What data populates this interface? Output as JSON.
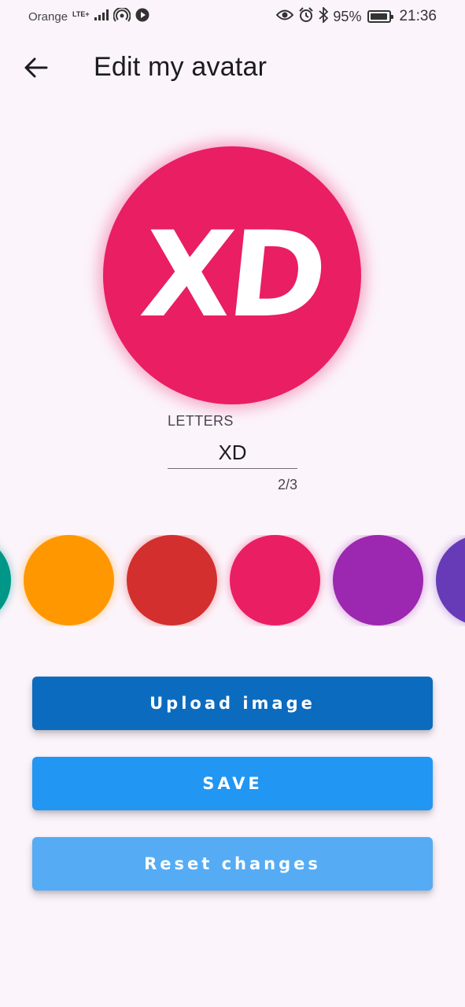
{
  "status_bar": {
    "carrier": "Orange",
    "network": "LTE+",
    "battery": "95%",
    "battery_level": 0.95,
    "time": "21:36"
  },
  "header": {
    "title": "Edit my avatar"
  },
  "avatar": {
    "letters": "XD",
    "color": "#e91e63"
  },
  "letters_field": {
    "label": "LETTERS",
    "value": "XD",
    "counter": "2/3"
  },
  "colors": [
    "#009688",
    "#ff9800",
    "#d32f2f",
    "#e91e63",
    "#9c27b0",
    "#673ab7"
  ],
  "buttons": {
    "upload": {
      "label": "Upload image",
      "color": "#0b6bbf"
    },
    "save": {
      "label": "SAVE",
      "color": "#2196f3"
    },
    "reset": {
      "label": "Reset changes",
      "color": "#55acf5"
    }
  }
}
